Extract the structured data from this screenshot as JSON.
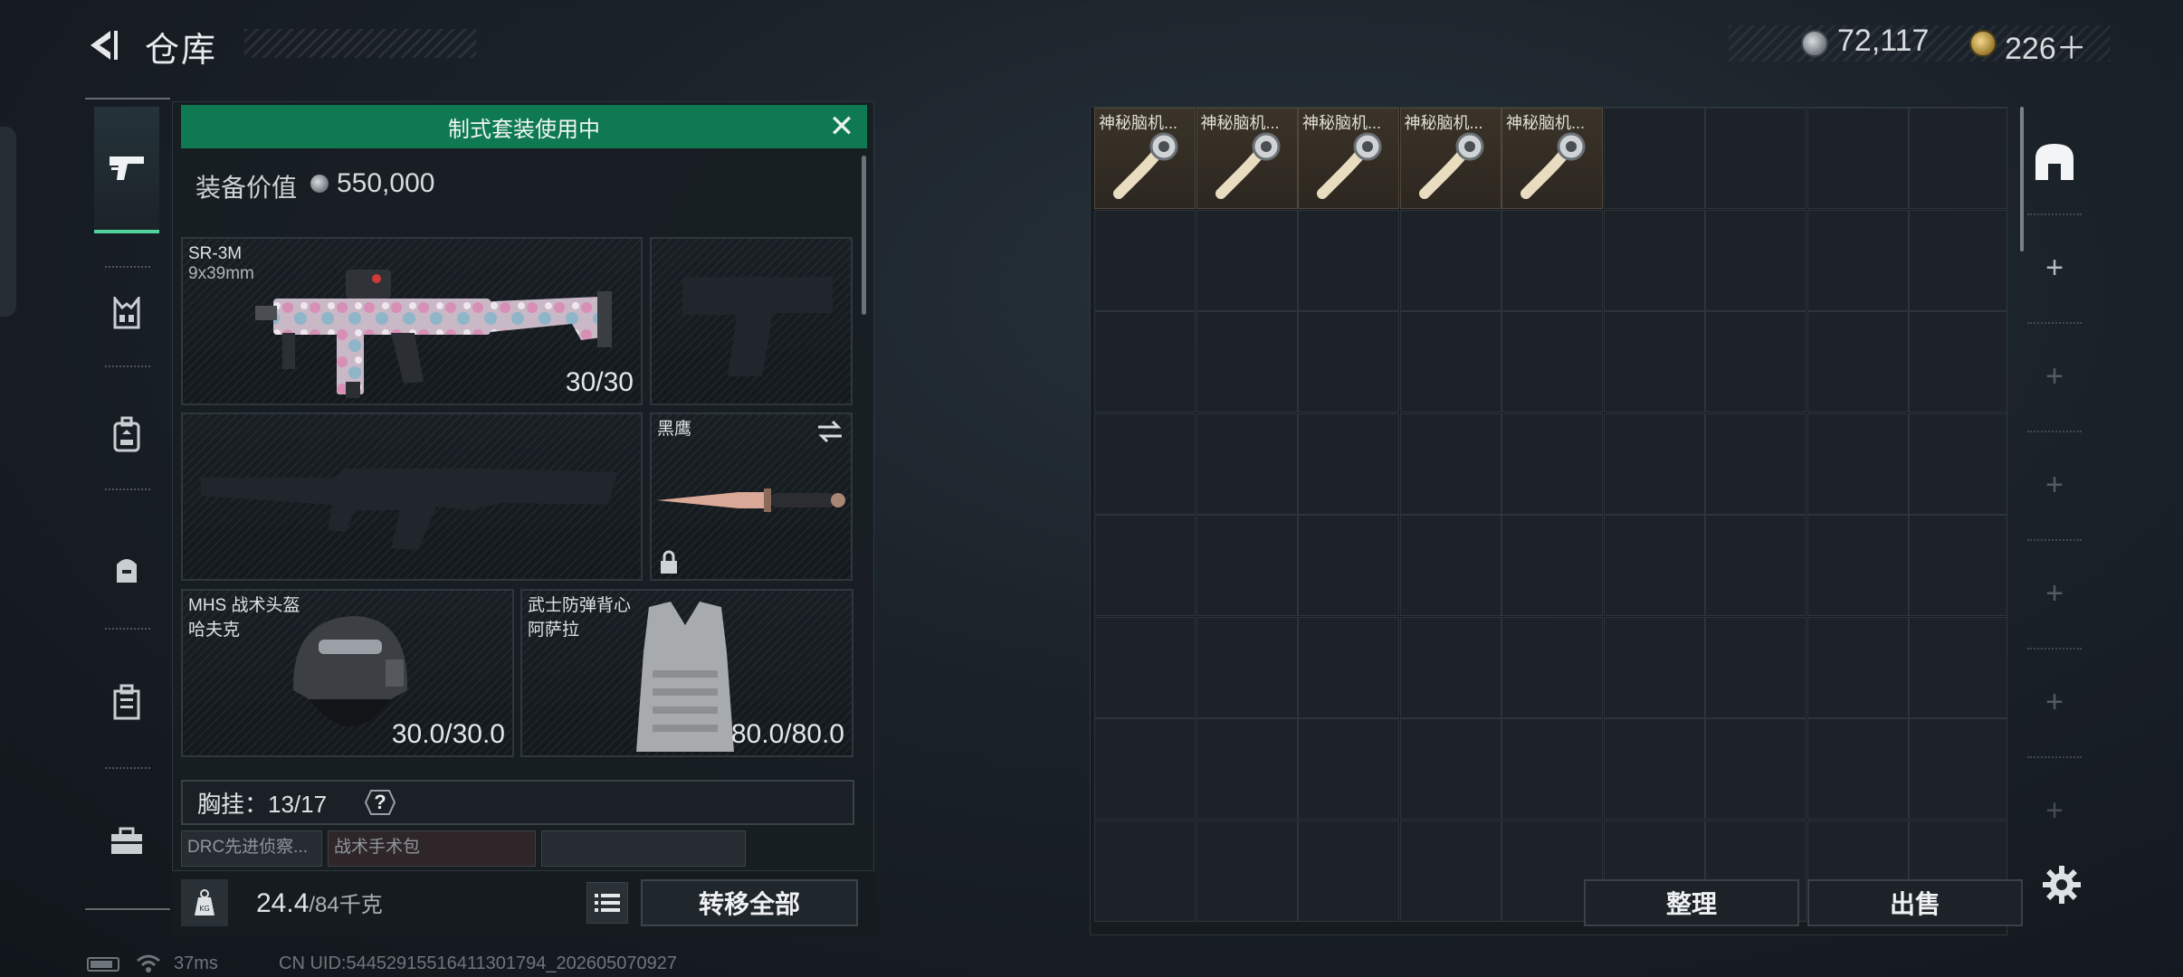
{
  "header": {
    "title": "仓库",
    "currency_primary": "72,117",
    "currency_secondary": "226＋",
    "back_icon": "back-arrow-icon"
  },
  "equipment": {
    "banner_text": "制式套装使用中",
    "value_label": "装备价值",
    "value_amount": "550,000",
    "primary_weapon": {
      "name": "SR-3M",
      "ammo_type": "9x39mm",
      "ammo": "30/30"
    },
    "melee": {
      "name": "黑鹰"
    },
    "helmet": {
      "name": "MHS 战术头盔",
      "variant": "哈夫克",
      "durability": "30.0/30.0"
    },
    "armor": {
      "name": "武士防弹背心",
      "variant": "阿萨拉",
      "durability": "80.0/80.0"
    },
    "chest_rig": {
      "label": "胸挂：13/17",
      "help": "?"
    },
    "mini_slots": [
      "DRC先进侦察...",
      "战术手术包",
      ""
    ],
    "weight_current": "24.4",
    "weight_max": "/84千克",
    "transfer_all": "转移全部"
  },
  "storage": {
    "items": [
      {
        "label": "神秘脑机..."
      },
      {
        "label": "神秘脑机..."
      },
      {
        "label": "神秘脑机..."
      },
      {
        "label": "神秘脑机..."
      },
      {
        "label": "神秘脑机..."
      }
    ],
    "sort_label": "整理",
    "sell_label": "出售"
  },
  "status": {
    "ping": "37ms",
    "uid": "CN UID:544529155164113017​94_202605070927"
  },
  "colors": {
    "accent_green": "#0f7a52",
    "active_tab": "#4fd39a",
    "item_bg": "#3a3328"
  }
}
